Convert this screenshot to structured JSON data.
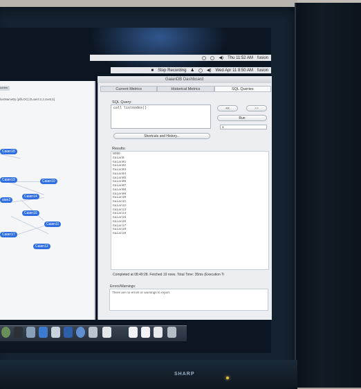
{
  "menubar_top": {
    "clock": "Thu 11:52 AM",
    "user": "fusion"
  },
  "menubar_second": {
    "recording": "Stop Recording",
    "clock": "Wed Apr 11 8:50 AM",
    "user": "fusion"
  },
  "left_window": {
    "tab_label": "ueries",
    "query_path": "lustNameBy (pillLOC):ZLow/4:2,3,4xx6,5]",
    "nodes": [
      "Caian18",
      "Caian19",
      "Caian10",
      "Caian14",
      "Caian16",
      "Caian11",
      "Caian17",
      "Caian12",
      "aian2"
    ]
  },
  "dashboard": {
    "title": "GaianDB Dashboard",
    "tabs": [
      "Current Metrics",
      "Historical Metrics",
      "SQL Queries"
    ],
    "selected_tab": "SQL Queries",
    "sql_label": "SQL Query:",
    "sql_text": "call listnodes()",
    "prev_button": "<<",
    "next_button": ">>",
    "run_button": "Run",
    "limit_value": "1",
    "shortcuts_label": "Shortcuts and History...",
    "results_label": "Results:",
    "results": [
      "NODE",
      "Gaian0",
      "Gaian01",
      "Gaian02",
      "Gaian03",
      "Gaian04",
      "Gaian05",
      "Gaian06",
      "Gaian07",
      "Gaian08",
      "Gaian09",
      "Gaian10",
      "Gaian11",
      "Gaian12",
      "Gaian13",
      "Gaian14",
      "Gaian15",
      "Gaian16",
      "Gaian17",
      "Gaian18",
      "Gaian19"
    ],
    "status": "Completed at 08:49:28. Fetched 19 rows. Total Time: 35ms (Execution Ti",
    "errors_label": "Errors/Warnings:",
    "errors_text": "There are no errors or warnings to report."
  },
  "monitor": {
    "brand": "SHARP"
  },
  "colors": {
    "bezel": "#15222f",
    "node": "#2f6fe0",
    "screen_bg": "#0c1622"
  }
}
